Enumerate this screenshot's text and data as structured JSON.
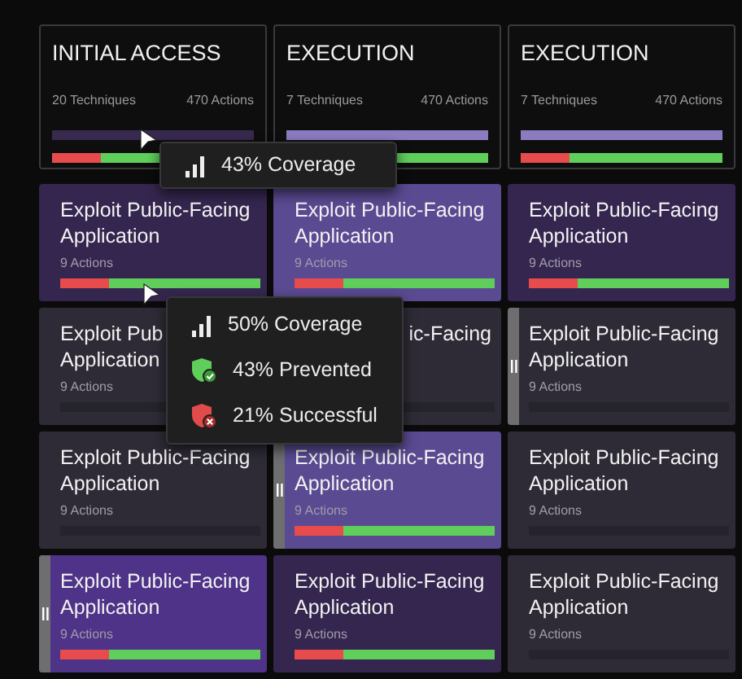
{
  "tactics": [
    {
      "title": "INITIAL ACCESS",
      "techniques": "20 Techniques",
      "actions": "470 Actions",
      "coverage": {
        "level": 0
      },
      "results": {
        "level": 0.24
      }
    },
    {
      "title": "EXECUTION",
      "techniques": "7 Techniques",
      "actions": "470 Actions",
      "coverage": {
        "level": 1
      },
      "results": {
        "level": 0.24
      }
    },
    {
      "title": "EXECUTION",
      "techniques": "7 Techniques",
      "actions": "470 Actions",
      "coverage": {
        "level": 1
      },
      "results": {
        "level": 0.24
      }
    }
  ],
  "columns": [
    {
      "cards": [
        {
          "title": "Exploit Public-Facing Application",
          "actions": "9 Actions",
          "color": "#35264f",
          "kind": "tested",
          "handle": false,
          "level": 0.24
        },
        {
          "title": "Exploit Pub Application",
          "actions": "9 Actions",
          "color": "#2e2b36",
          "kind": "untested",
          "handle": false
        },
        {
          "title": "Exploit Public-Facing Application",
          "actions": "9 Actions",
          "color": "#2e2b36",
          "kind": "untested",
          "handle": false
        },
        {
          "title": "Exploit Public-Facing Application",
          "actions": "9 Actions",
          "color": "#4e3388",
          "kind": "tested",
          "handle": true,
          "level": 0.24
        }
      ]
    },
    {
      "cards": [
        {
          "title": "Exploit Public-Facing Application",
          "actions": "9 Actions",
          "color": "#5a4a92",
          "kind": "tested",
          "handle": false,
          "level": 0.24
        },
        {
          "title": "ic-Facing",
          "color": "#2e2b36",
          "kind": "untested",
          "handle": false,
          "covered": true
        },
        {
          "title": "Exploit Public-Facing Application",
          "actions": "9 Actions",
          "color": "#5a4a92",
          "kind": "tested",
          "handle": true,
          "level": 0.24
        },
        {
          "title": "Exploit Public-Facing Application",
          "actions": "9 Actions",
          "color": "#35264f",
          "kind": "tested",
          "handle": false,
          "level": 0.24
        }
      ]
    },
    {
      "cards": [
        {
          "title": "Exploit Public-Facing Application",
          "actions": "9 Actions",
          "color": "#35264f",
          "kind": "tested",
          "handle": false,
          "level": 0.24
        },
        {
          "title": "Exploit Public-Facing Application",
          "actions": "9 Actions",
          "color": "#2e2b36",
          "kind": "untested",
          "handle": true
        },
        {
          "title": "Exploit Public-Facing Application",
          "actions": "9 Actions",
          "color": "#2e2b36",
          "kind": "untested",
          "handle": false
        },
        {
          "title": "Exploit Public-Facing Application",
          "actions": "9 Actions",
          "color": "#2e2b36",
          "kind": "untested",
          "handle": false
        }
      ]
    }
  ],
  "tooltips": [
    {
      "rows": [
        {
          "kind": "coverage",
          "text": "43% Coverage"
        }
      ]
    },
    {
      "rows": [
        {
          "kind": "coverage",
          "text": "50% Coverage"
        },
        {
          "kind": "prevented",
          "text": "43% Prevented"
        },
        {
          "kind": "successful",
          "text": "21% Successful"
        }
      ]
    }
  ]
}
